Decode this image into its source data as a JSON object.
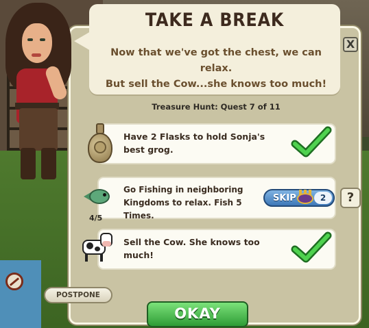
{
  "dialog": {
    "title": "TAKE A BREAK",
    "message_line1": "Now that we've got the chest, we can relax.",
    "message_line2": "But sell the Cow...she knows too much!",
    "progress": "Treasure Hunt: Quest 7 of 11",
    "close_label": "X"
  },
  "tasks": [
    {
      "text_line1": "Have 2 Flasks to hold Sonja's",
      "text_line2": "best grog.",
      "icon": "flask-icon",
      "complete": true
    },
    {
      "text_line1": "Go Fishing in neighboring",
      "text_line2": "Kingdoms to relax. Fish 5 Times.",
      "icon": "fish-icon",
      "count": "4/5",
      "complete": false,
      "skip_label": "SKIP",
      "skip_cost": "2",
      "help_label": "?"
    },
    {
      "text_line1": "Sell the Cow. She knows too",
      "text_line2": "much!",
      "icon": "cow-icon",
      "complete": true
    }
  ],
  "buttons": {
    "postpone_label": "POSTPONE",
    "okay_label": "OKAY"
  },
  "colors": {
    "panel": "#c9c3a3",
    "bubble": "#f4efdc",
    "check_green": "#3bbf3d",
    "skip_blue": "#3e78b8",
    "okay_green": "#2f9c36"
  }
}
